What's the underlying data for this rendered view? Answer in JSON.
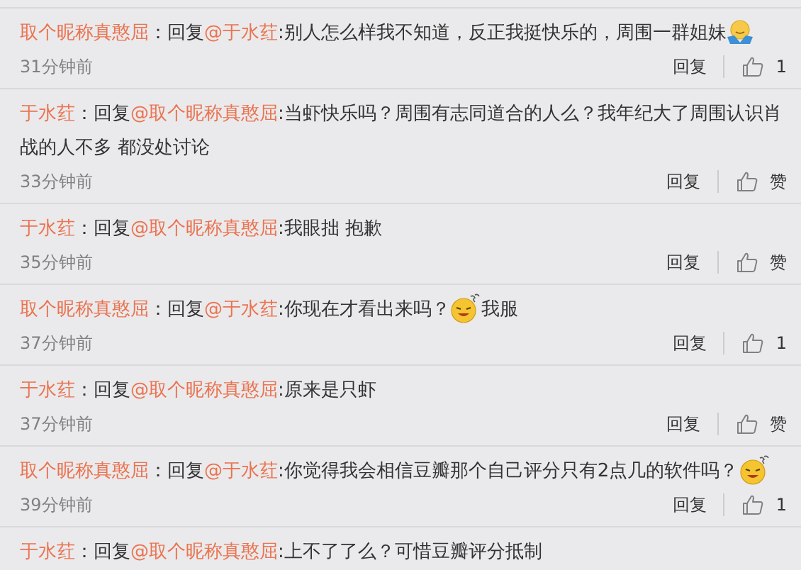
{
  "comments": [
    {
      "author": "取个昵称真憨屈",
      "separator": "：",
      "reply_word": "回复",
      "mention": "@于水荭",
      "text": ":别人怎么样我不知道，反正我挺快乐的，周围一群姐妹",
      "emoji": {
        "kind": "shrug"
      },
      "time": "31分钟前",
      "reply_label": "回复",
      "like_label": "1"
    },
    {
      "author": "于水荭",
      "separator": "：",
      "reply_word": "回复",
      "mention": "@取个昵称真憨屈",
      "text": ":当虾快乐吗？周围有志同道合的人么？我年纪大了周围认识肖战的人不多 都没处讨论",
      "time": "33分钟前",
      "reply_label": "回复",
      "like_label": "赞"
    },
    {
      "author": "于水荭",
      "separator": "：",
      "reply_word": "回复",
      "mention": "@取个昵称真憨屈",
      "text": ":我眼拙 抱歉",
      "time": "35分钟前",
      "reply_label": "回复",
      "like_label": "赞"
    },
    {
      "author": "取个昵称真憨屈",
      "separator": "：",
      "reply_word": "回复",
      "mention": "@于水荭",
      "text": ":你现在才看出来吗？",
      "emoji": {
        "kind": "dizzy"
      },
      "after_emoji": "我服",
      "time": "37分钟前",
      "reply_label": "回复",
      "like_label": "1"
    },
    {
      "author": "于水荭",
      "separator": "：",
      "reply_word": "回复",
      "mention": "@取个昵称真憨屈",
      "text": ":原来是只虾",
      "time": "37分钟前",
      "reply_label": "回复",
      "like_label": "赞"
    },
    {
      "author": "取个昵称真憨屈",
      "separator": "：",
      "reply_word": "回复",
      "mention": "@于水荭",
      "text": ":你觉得我会相信豆瓣那个自己评分只有2点几的软件吗？",
      "emoji": {
        "kind": "dizzy"
      },
      "time": "39分钟前",
      "reply_label": "回复",
      "like_label": "1"
    },
    {
      "author": "于水荭",
      "separator": "：",
      "reply_word": "回复",
      "mention": "@取个昵称真憨屈",
      "text": ":上不了了么？可惜豆瓣评分抵制"
    }
  ]
}
